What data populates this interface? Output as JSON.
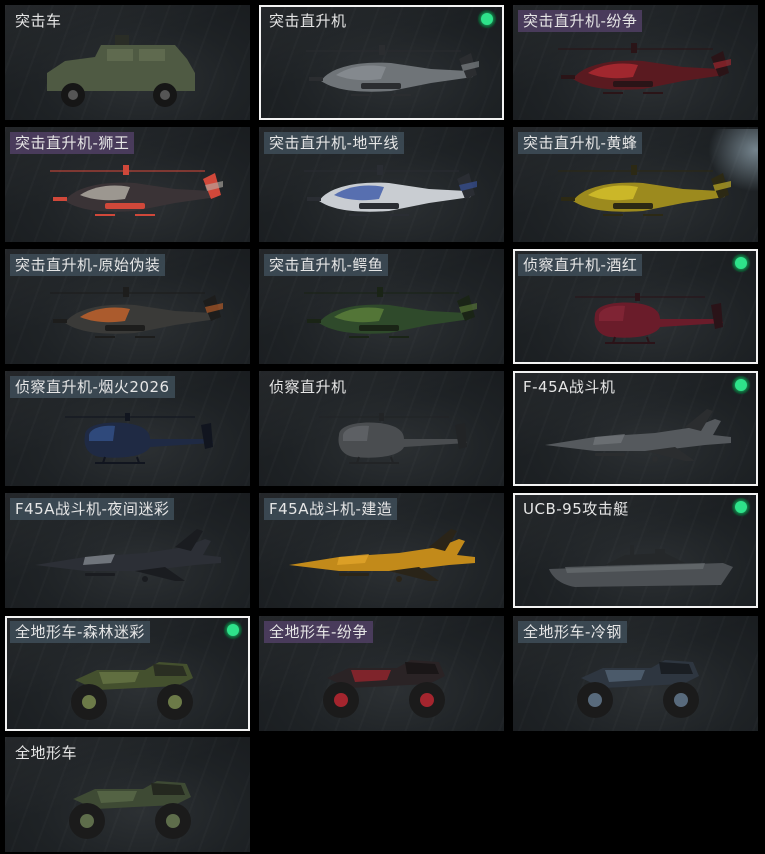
{
  "grid": {
    "items": [
      {
        "label": "突击车",
        "kind": "armored-car-icon",
        "tint": "none",
        "selected": false,
        "colors": [
          "#4f5a43",
          "#6b7559",
          "#2a2d26"
        ]
      },
      {
        "label": "突击直升机",
        "kind": "attack-helicopter-icon",
        "tint": "none",
        "selected": true,
        "colors": [
          "#6f7478",
          "#8a8f93",
          "#2b2d30"
        ]
      },
      {
        "label": "突击直升机-纷争",
        "kind": "attack-helicopter-icon",
        "tint": "purple",
        "selected": false,
        "colors": [
          "#5a1a20",
          "#b12a32",
          "#2a1417"
        ]
      },
      {
        "label": "突击直升机-狮王",
        "kind": "attack-helicopter-icon",
        "tint": "purple",
        "selected": false,
        "colors": [
          "#3a3336",
          "#b5b0a8",
          "#d0483a"
        ]
      },
      {
        "label": "突击直升机-地平线",
        "kind": "attack-helicopter-icon",
        "tint": "slate",
        "selected": false,
        "colors": [
          "#c9cdd2",
          "#3b57a8",
          "#2a2d33"
        ]
      },
      {
        "label": "突击直升机-黄蜂",
        "kind": "attack-helicopter-icon",
        "tint": "slate",
        "selected": false,
        "colors": [
          "#9c8a1e",
          "#d7c22a",
          "#2c2914"
        ]
      },
      {
        "label": "突击直升机-原始伪装",
        "kind": "attack-helicopter-icon",
        "tint": "slate",
        "selected": false,
        "colors": [
          "#3a3a38",
          "#c8642a",
          "#1d1d1c"
        ]
      },
      {
        "label": "突击直升机-鳄鱼",
        "kind": "attack-helicopter-icon",
        "tint": "slate",
        "selected": false,
        "colors": [
          "#2f4a2b",
          "#5d7f3b",
          "#1a2416"
        ]
      },
      {
        "label": "侦察直升机-酒红",
        "kind": "scout-helicopter-icon",
        "tint": "slate",
        "selected": true,
        "colors": [
          "#6a1c2a",
          "#8e2a3c",
          "#2a1318"
        ]
      },
      {
        "label": "侦察直升机-烟火2026",
        "kind": "scout-helicopter-icon",
        "tint": "slate",
        "selected": false,
        "colors": [
          "#1f2a44",
          "#3b5fa0",
          "#11151f"
        ]
      },
      {
        "label": "侦察直升机",
        "kind": "scout-helicopter-icon",
        "tint": "none",
        "selected": false,
        "colors": [
          "#4a4d50",
          "#6a6e72",
          "#222426"
        ]
      },
      {
        "label": "F-45A战斗机",
        "kind": "fighter-jet-icon",
        "tint": "none",
        "selected": true,
        "colors": [
          "#55595d",
          "#74787c",
          "#2b2d2f"
        ]
      },
      {
        "label": "F45A战斗机-夜间迷彩",
        "kind": "fighter-jet-icon",
        "tint": "slate",
        "selected": false,
        "colors": [
          "#2c2f36",
          "#8d939a",
          "#1a1c20"
        ]
      },
      {
        "label": "F45A战斗机-建造",
        "kind": "fighter-jet-icon",
        "tint": "slate",
        "selected": false,
        "colors": [
          "#c28a1a",
          "#e6a82c",
          "#2a2418"
        ]
      },
      {
        "label": "UCB-95攻击艇",
        "kind": "attack-boat-icon",
        "tint": "none",
        "selected": true,
        "colors": [
          "#4c5054",
          "#6e7377",
          "#25282a"
        ]
      },
      {
        "label": "全地形车-森林迷彩",
        "kind": "atv-icon",
        "tint": "slate",
        "selected": true,
        "colors": [
          "#44502e",
          "#6c7a48",
          "#2a2e22"
        ]
      },
      {
        "label": "全地形车-纷争",
        "kind": "atv-icon",
        "tint": "purple",
        "selected": false,
        "colors": [
          "#2a2325",
          "#a4252e",
          "#1a1617"
        ]
      },
      {
        "label": "全地形车-冷钢",
        "kind": "atv-icon",
        "tint": "slate",
        "selected": false,
        "colors": [
          "#2e3640",
          "#586a7c",
          "#1a1e23"
        ]
      },
      {
        "label": "全地形车",
        "kind": "atv-icon",
        "tint": "none",
        "selected": false,
        "colors": [
          "#3e4a34",
          "#5e6d4b",
          "#24281f"
        ]
      }
    ]
  }
}
